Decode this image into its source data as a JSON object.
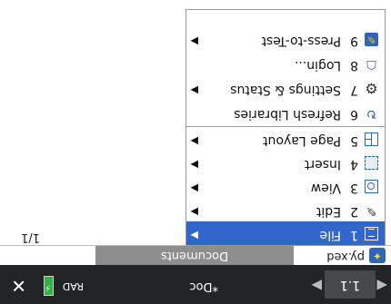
{
  "topbar": {
    "left_arrow": "◀",
    "tab_label": "1.1",
    "right_arrow": "▶",
    "document_name": "*Doc",
    "angle_mode": "RAD",
    "battery_symbol": "⚡",
    "close_symbol": "✕"
  },
  "documents_row": {
    "file_icon": "python-file-icon",
    "file_name": "py.xed",
    "title": "Documents"
  },
  "page_indicator": "1/1",
  "menu": {
    "items": [
      {
        "num": "1",
        "label": "File",
        "icon": "file-icon",
        "submenu": true
      },
      {
        "num": "2",
        "label": "Edit",
        "icon": "pencil-icon",
        "submenu": true
      },
      {
        "num": "3",
        "label": "View",
        "icon": "view-icon",
        "submenu": true
      },
      {
        "num": "4",
        "label": "Insert",
        "icon": "insert-icon",
        "submenu": true
      },
      {
        "num": "5",
        "label": "Page Layout",
        "icon": "page-layout-icon",
        "submenu": true
      },
      {
        "num": "6",
        "label": "Refresh Libraries",
        "icon": "refresh-icon",
        "submenu": false
      },
      {
        "num": "7",
        "label": "Settings & Status",
        "icon": "gear-icon",
        "submenu": true
      },
      {
        "num": "8",
        "label": "Login...",
        "icon": "login-icon",
        "submenu": false
      },
      {
        "num": "9",
        "label": "Press-to-Test",
        "icon": "press-to-test-icon",
        "submenu": true
      }
    ],
    "submenu_arrow": "▶"
  },
  "colors": {
    "selection": "#3366cc",
    "topbar": "#222426",
    "header": "#8e8e8e",
    "battery": "#2fb344",
    "accent": "#2f66b8"
  }
}
